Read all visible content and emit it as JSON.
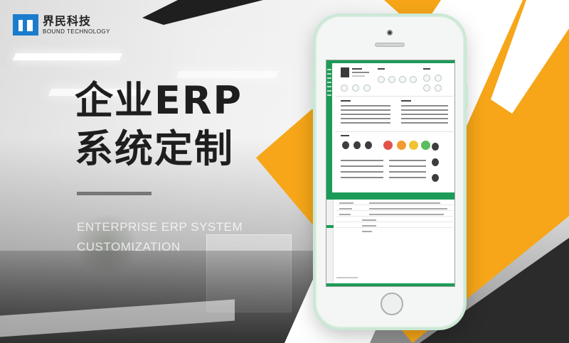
{
  "brand": {
    "logo_cn": "界民科技",
    "logo_en": "BOUND TECHNOLOGY",
    "logo_icon": "brand-square-icon",
    "accent_color": "#1b7ccd"
  },
  "headline": {
    "line1": "企业ERP",
    "line2": "系统定制"
  },
  "subtitle": {
    "line1": "ENTERPRISE ERP SYSTEM",
    "line2": "CUSTOMIZATION"
  },
  "colors": {
    "orange": "#f6a618",
    "dark": "#2b2b2b",
    "erp_green": "#1c9b57"
  },
  "phone": {
    "device_icon": "smartphone-icon",
    "screen_content": "erp-dashboard-thumbnail"
  }
}
